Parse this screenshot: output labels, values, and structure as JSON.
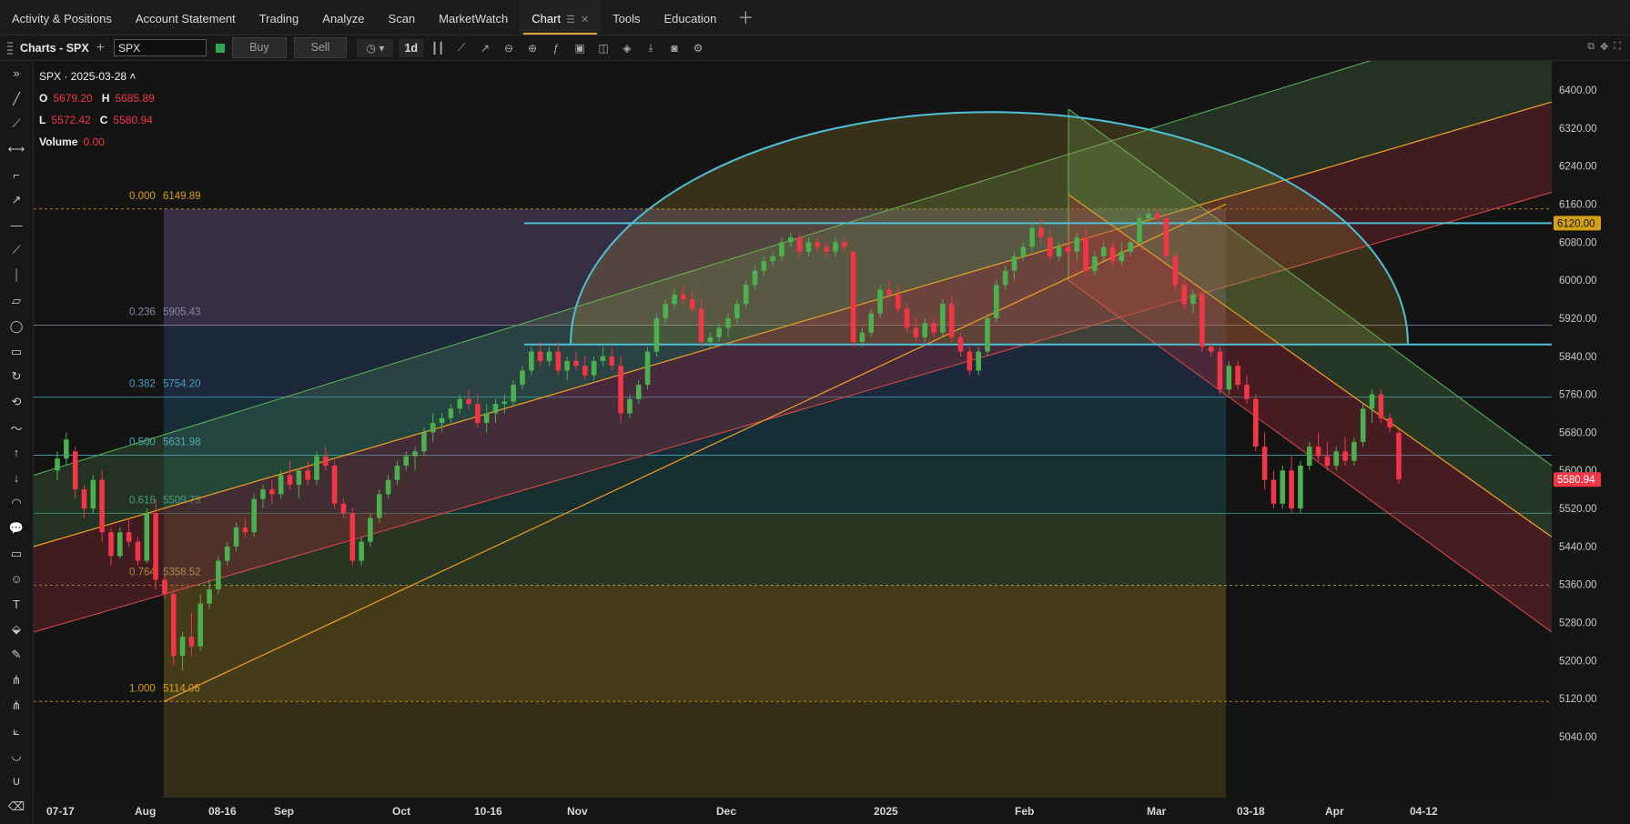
{
  "nav": {
    "tabs": [
      "Activity & Positions",
      "Account Statement",
      "Trading",
      "Analyze",
      "Scan",
      "MarketWatch",
      "Chart",
      "Tools",
      "Education"
    ],
    "active": "Chart"
  },
  "toolbar": {
    "title": "Charts - SPX",
    "symbol": "SPX",
    "buy_label": "Buy",
    "sell_label": "Sell",
    "interval": "1d",
    "link_color": "#2fa84f"
  },
  "ohlc": {
    "symbol_date": "SPX · 2025-03-28",
    "o_label": "O",
    "o": "5679.20",
    "h_label": "H",
    "h": "5685.89",
    "l_label": "L",
    "l": "5572.42",
    "c_label": "C",
    "c": "5580.94",
    "vol_label": "Volume",
    "vol": "0.00"
  },
  "left_tools": [
    "chevrons-icon",
    "line-icon",
    "ray-icon",
    "horizontal-ray-icon",
    "brush-icon",
    "arrow-up-right-icon",
    "horizontal-line-icon",
    "extended-line-icon",
    "vertical-line-icon",
    "parallelogram-icon",
    "ellipse-icon",
    "rectangle-icon",
    "arc-icon",
    "curve-icon",
    "path-icon",
    "arrow-up-icon",
    "arrow-down-icon",
    "semicircle-icon",
    "callout-icon",
    "comment-icon",
    "smiley-icon",
    "text-icon",
    "paint-bucket-icon",
    "pencil-icon",
    "pitchfork-icon",
    "schiff-pitchfork-icon",
    "fan-icon",
    "gann-icon",
    "magnet-icon",
    "eraser-icon"
  ],
  "chart_data": {
    "type": "candlestick",
    "symbol": "SPX",
    "y_ticks": [
      6400,
      6320,
      6240,
      6160,
      6080,
      6000,
      5920,
      5840,
      5760,
      5680,
      5600,
      5520,
      5440,
      5360,
      5280,
      5200,
      5120,
      5040
    ],
    "y_labels": [
      "6400.00",
      "6320.00",
      "6240.00",
      "6160.00",
      "6080.00",
      "6000.00",
      "5920.00",
      "5840.00",
      "5760.00",
      "5680.00",
      "5600.00",
      "5520.00",
      "5440.00",
      "5360.00",
      "5280.00",
      "5200.00",
      "5120.00",
      "5040.00"
    ],
    "x_labels": [
      "07-17",
      "Aug",
      "08-16",
      "Sep",
      "Oct",
      "10-16",
      "Nov",
      "Dec",
      "2025",
      "Feb",
      "Mar",
      "03-18",
      "Apr",
      "04-12"
    ],
    "last_price": "5580.94",
    "hline_price": "6120.00",
    "fib_levels": [
      {
        "ratio": "0.000",
        "price": "6149.89",
        "color": "#d4a017"
      },
      {
        "ratio": "0.236",
        "price": "5905.43",
        "color": "#8a86a5"
      },
      {
        "ratio": "0.382",
        "price": "5754.20",
        "color": "#4a9fc1"
      },
      {
        "ratio": "0.500",
        "price": "5631.98",
        "color": "#4ab0c9"
      },
      {
        "ratio": "0.618",
        "price": "5509.73",
        "color": "#3f9a8a"
      },
      {
        "ratio": "0.764",
        "price": "5358.52",
        "color": "#b9b84a"
      },
      {
        "ratio": "1.000",
        "price": "5114.06",
        "color": "#d4a017"
      }
    ],
    "ohlc_series": [
      [
        5600,
        5640,
        5580,
        5625
      ],
      [
        5625,
        5680,
        5610,
        5665
      ],
      [
        5640,
        5650,
        5540,
        5560
      ],
      [
        5560,
        5570,
        5500,
        5520
      ],
      [
        5520,
        5590,
        5510,
        5580
      ],
      [
        5580,
        5600,
        5450,
        5470
      ],
      [
        5470,
        5480,
        5400,
        5420
      ],
      [
        5420,
        5480,
        5415,
        5470
      ],
      [
        5470,
        5500,
        5440,
        5450
      ],
      [
        5450,
        5460,
        5400,
        5410
      ],
      [
        5410,
        5520,
        5405,
        5510
      ],
      [
        5510,
        5540,
        5350,
        5370
      ],
      [
        5370,
        5380,
        5330,
        5340
      ],
      [
        5340,
        5350,
        5190,
        5210
      ],
      [
        5210,
        5260,
        5180,
        5250
      ],
      [
        5250,
        5300,
        5210,
        5230
      ],
      [
        5230,
        5340,
        5220,
        5320
      ],
      [
        5320,
        5370,
        5310,
        5350
      ],
      [
        5350,
        5420,
        5340,
        5410
      ],
      [
        5410,
        5450,
        5400,
        5440
      ],
      [
        5440,
        5490,
        5430,
        5480
      ],
      [
        5480,
        5500,
        5460,
        5470
      ],
      [
        5470,
        5550,
        5460,
        5540
      ],
      [
        5540,
        5570,
        5520,
        5560
      ],
      [
        5560,
        5580,
        5530,
        5550
      ],
      [
        5550,
        5600,
        5540,
        5590
      ],
      [
        5590,
        5620,
        5560,
        5570
      ],
      [
        5570,
        5600,
        5540,
        5600
      ],
      [
        5600,
        5620,
        5570,
        5580
      ],
      [
        5580,
        5640,
        5570,
        5630
      ],
      [
        5630,
        5650,
        5600,
        5610
      ],
      [
        5610,
        5620,
        5520,
        5530
      ],
      [
        5530,
        5540,
        5500,
        5510
      ],
      [
        5510,
        5520,
        5400,
        5410
      ],
      [
        5410,
        5460,
        5400,
        5450
      ],
      [
        5450,
        5510,
        5440,
        5500
      ],
      [
        5500,
        5560,
        5490,
        5550
      ],
      [
        5550,
        5590,
        5540,
        5580
      ],
      [
        5580,
        5620,
        5570,
        5610
      ],
      [
        5610,
        5640,
        5600,
        5630
      ],
      [
        5630,
        5650,
        5600,
        5640
      ],
      [
        5640,
        5690,
        5630,
        5680
      ],
      [
        5680,
        5720,
        5660,
        5700
      ],
      [
        5700,
        5720,
        5680,
        5710
      ],
      [
        5710,
        5740,
        5700,
        5730
      ],
      [
        5730,
        5760,
        5720,
        5750
      ],
      [
        5750,
        5770,
        5730,
        5740
      ],
      [
        5740,
        5760,
        5690,
        5700
      ],
      [
        5700,
        5740,
        5680,
        5720
      ],
      [
        5720,
        5750,
        5700,
        5740
      ],
      [
        5740,
        5760,
        5720,
        5745
      ],
      [
        5745,
        5790,
        5735,
        5780
      ],
      [
        5780,
        5820,
        5770,
        5810
      ],
      [
        5810,
        5860,
        5800,
        5850
      ],
      [
        5850,
        5870,
        5820,
        5830
      ],
      [
        5830,
        5860,
        5820,
        5850
      ],
      [
        5850,
        5870,
        5800,
        5810
      ],
      [
        5810,
        5840,
        5790,
        5830
      ],
      [
        5830,
        5850,
        5810,
        5820
      ],
      [
        5820,
        5840,
        5790,
        5800
      ],
      [
        5800,
        5840,
        5790,
        5830
      ],
      [
        5830,
        5860,
        5820,
        5840
      ],
      [
        5840,
        5860,
        5810,
        5820
      ],
      [
        5820,
        5840,
        5700,
        5720
      ],
      [
        5720,
        5760,
        5710,
        5750
      ],
      [
        5750,
        5790,
        5740,
        5780
      ],
      [
        5780,
        5860,
        5770,
        5850
      ],
      [
        5850,
        5930,
        5840,
        5920
      ],
      [
        5920,
        5960,
        5910,
        5950
      ],
      [
        5950,
        5980,
        5940,
        5970
      ],
      [
        5970,
        5990,
        5950,
        5960
      ],
      [
        5960,
        5980,
        5930,
        5940
      ],
      [
        5940,
        5960,
        5860,
        5870
      ],
      [
        5870,
        5890,
        5860,
        5880
      ],
      [
        5880,
        5910,
        5870,
        5900
      ],
      [
        5900,
        5930,
        5880,
        5920
      ],
      [
        5920,
        5960,
        5910,
        5950
      ],
      [
        5950,
        6000,
        5940,
        5990
      ],
      [
        5990,
        6030,
        5980,
        6020
      ],
      [
        6020,
        6050,
        6010,
        6040
      ],
      [
        6040,
        6060,
        6030,
        6050
      ],
      [
        6050,
        6090,
        6040,
        6080
      ],
      [
        6080,
        6100,
        6070,
        6090
      ],
      [
        6090,
        6100,
        6050,
        6060
      ],
      [
        6060,
        6090,
        6050,
        6080
      ],
      [
        6080,
        6090,
        6060,
        6070
      ],
      [
        6070,
        6080,
        6050,
        6060
      ],
      [
        6060,
        6090,
        6050,
        6080
      ],
      [
        6080,
        6090,
        6060,
        6070
      ],
      [
        6060,
        6060,
        5860,
        5870
      ],
      [
        5870,
        5900,
        5860,
        5890
      ],
      [
        5890,
        5940,
        5880,
        5930
      ],
      [
        5930,
        5990,
        5920,
        5980
      ],
      [
        5980,
        6000,
        5960,
        5970
      ],
      [
        5970,
        5990,
        5930,
        5940
      ],
      [
        5940,
        5950,
        5890,
        5900
      ],
      [
        5900,
        5920,
        5870,
        5880
      ],
      [
        5880,
        5920,
        5870,
        5910
      ],
      [
        5910,
        5920,
        5880,
        5890
      ],
      [
        5890,
        5960,
        5880,
        5950
      ],
      [
        5950,
        5970,
        5870,
        5880
      ],
      [
        5880,
        5890,
        5840,
        5850
      ],
      [
        5850,
        5860,
        5800,
        5810
      ],
      [
        5810,
        5860,
        5800,
        5850
      ],
      [
        5850,
        5930,
        5840,
        5920
      ],
      [
        5920,
        6000,
        5910,
        5990
      ],
      [
        5990,
        6030,
        5980,
        6020
      ],
      [
        6020,
        6060,
        6000,
        6050
      ],
      [
        6050,
        6080,
        6040,
        6070
      ],
      [
        6070,
        6120,
        6060,
        6110
      ],
      [
        6110,
        6130,
        6080,
        6090
      ],
      [
        6090,
        6110,
        6040,
        6050
      ],
      [
        6050,
        6080,
        6040,
        6070
      ],
      [
        6070,
        6090,
        6050,
        6060
      ],
      [
        6060,
        6100,
        6040,
        6090
      ],
      [
        6090,
        6110,
        6010,
        6020
      ],
      [
        6020,
        6060,
        6010,
        6050
      ],
      [
        6050,
        6080,
        6040,
        6070
      ],
      [
        6070,
        6080,
        6030,
        6040
      ],
      [
        6040,
        6080,
        6030,
        6060
      ],
      [
        6060,
        6090,
        6050,
        6080
      ],
      [
        6080,
        6140,
        6070,
        6130
      ],
      [
        6130,
        6150,
        6120,
        6140
      ],
      [
        6140,
        6150,
        6120,
        6130
      ],
      [
        6130,
        6140,
        6040,
        6050
      ],
      [
        6050,
        6060,
        5980,
        5990
      ],
      [
        5990,
        6000,
        5940,
        5950
      ],
      [
        5950,
        5980,
        5930,
        5970
      ],
      [
        5970,
        5980,
        5850,
        5860
      ],
      [
        5860,
        5870,
        5840,
        5850
      ],
      [
        5850,
        5860,
        5760,
        5770
      ],
      [
        5770,
        5830,
        5760,
        5820
      ],
      [
        5820,
        5830,
        5770,
        5780
      ],
      [
        5780,
        5800,
        5740,
        5750
      ],
      [
        5750,
        5760,
        5640,
        5650
      ],
      [
        5650,
        5680,
        5560,
        5580
      ],
      [
        5580,
        5600,
        5520,
        5530
      ],
      [
        5530,
        5610,
        5520,
        5600
      ],
      [
        5600,
        5630,
        5510,
        5520
      ],
      [
        5520,
        5620,
        5510,
        5610
      ],
      [
        5610,
        5660,
        5600,
        5650
      ],
      [
        5650,
        5680,
        5620,
        5630
      ],
      [
        5630,
        5660,
        5600,
        5610
      ],
      [
        5610,
        5650,
        5600,
        5640
      ],
      [
        5640,
        5670,
        5610,
        5620
      ],
      [
        5620,
        5670,
        5610,
        5660
      ],
      [
        5660,
        5740,
        5650,
        5730
      ],
      [
        5730,
        5770,
        5700,
        5760
      ],
      [
        5760,
        5770,
        5700,
        5710
      ],
      [
        5710,
        5720,
        5680,
        5690
      ],
      [
        5679.2,
        5685.89,
        5572.42,
        5580.94
      ]
    ]
  }
}
